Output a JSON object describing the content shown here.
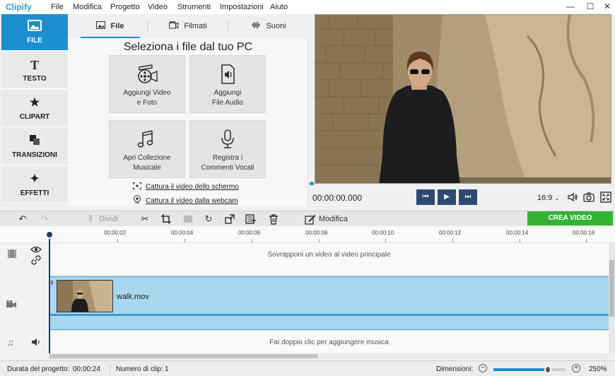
{
  "app": {
    "logo": "Clipify"
  },
  "menu": [
    "File",
    "Modifica",
    "Progetto",
    "Video",
    "Strumenti",
    "Impostazioni",
    "Aiuto"
  ],
  "window_controls": {
    "minimize": "—",
    "maximize": "☐",
    "close": "✕"
  },
  "sidebar": {
    "items": [
      {
        "label": "FILE",
        "icon": "image-icon",
        "active": true
      },
      {
        "label": "TESTO",
        "icon": "text-icon",
        "active": false
      },
      {
        "label": "CLIPART",
        "icon": "star-icon",
        "active": false
      },
      {
        "label": "TRANSIZIONI",
        "icon": "transitions-icon",
        "active": false
      },
      {
        "label": "EFFETTI",
        "icon": "magic-wand-icon",
        "active": false
      }
    ]
  },
  "panel": {
    "tabs": [
      {
        "label": "File",
        "icon": "image-icon",
        "active": true
      },
      {
        "label": "Filmati",
        "icon": "film-icon",
        "active": false
      },
      {
        "label": "Suoni",
        "icon": "waveform-icon",
        "active": false
      }
    ],
    "title": "Seleziona i file dal tuo PC",
    "cards": [
      {
        "line1": "Aggiungi Video",
        "line2": "e Foto",
        "icon": "film-reel-icon"
      },
      {
        "line1": "Aggiungi",
        "line2": "File Audio",
        "icon": "audio-file-icon"
      },
      {
        "line1": "Apri Collezione",
        "line2": "Musicale",
        "icon": "music-notes-icon"
      },
      {
        "line1": "Registra i",
        "line2": "Commenti Vocali",
        "icon": "microphone-icon"
      }
    ],
    "links": [
      {
        "label": "Cattura il video dello schermo",
        "icon": "screen-capture-icon"
      },
      {
        "label": "Cattura il video dalla webcam",
        "icon": "webcam-icon"
      }
    ]
  },
  "player": {
    "timecode": "00:00:00.000",
    "aspect": "16:9",
    "buttons": {
      "prev": "⏮",
      "play": "▶",
      "next": "⏭"
    }
  },
  "toolbar": {
    "split_label": "Dividi",
    "edit_label": "Modifica",
    "export_label": "CREA VIDEO"
  },
  "timeline": {
    "ticks": [
      "00:00:02",
      "00:00:04",
      "00:00:06",
      "00:00:08",
      "00:00:10",
      "00:00:12",
      "00:00:14",
      "00:00:16"
    ],
    "overlay_hint": "Sovrapponi un video al video principale",
    "clip_name": "walk.mov",
    "music_hint": "Fai doppio clic per aggiungere musica"
  },
  "status": {
    "duration_label": "Durata del progetto:",
    "duration_value": "00:00:24",
    "clips_label": "Numero di clip:",
    "clips_value": "1",
    "zoom_label": "Dimensioni:",
    "zoom_value": "250%",
    "zoom_level": 0.76
  },
  "colors": {
    "accent": "#1c8fd0",
    "export": "#34b234",
    "clip_track": "#a8d8f0",
    "player_button": "#2f4a72"
  }
}
